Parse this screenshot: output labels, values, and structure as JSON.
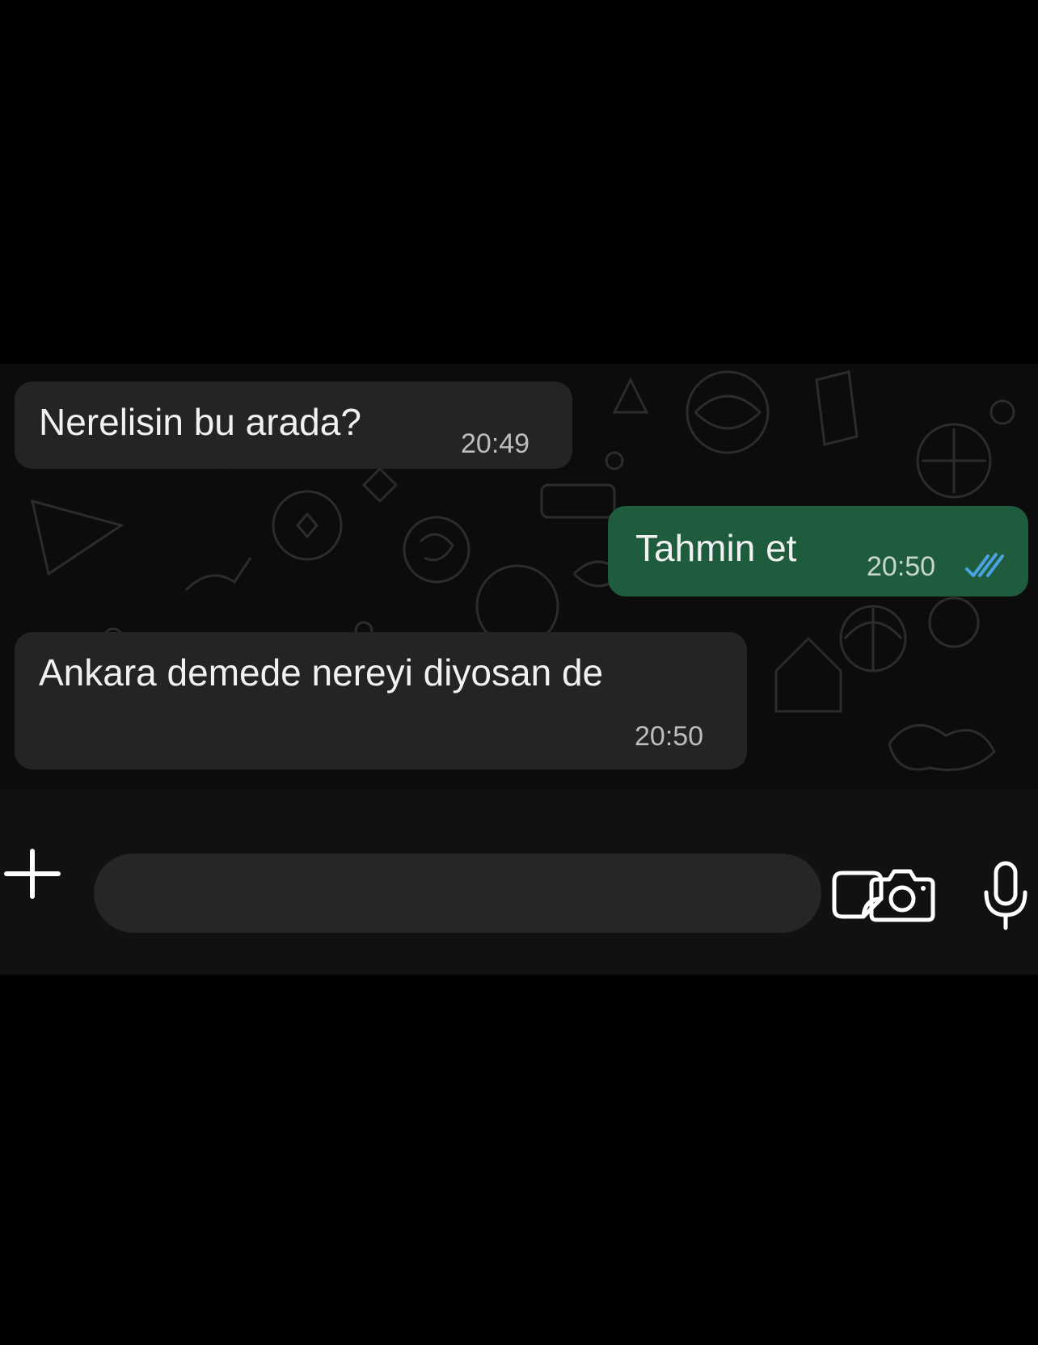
{
  "chat": {
    "messages": [
      {
        "direction": "incoming",
        "text": "Nerelisin bu arada?",
        "time": "20:49"
      },
      {
        "direction": "outgoing",
        "text": "Tahmin et",
        "time": "20:50",
        "status": "read"
      },
      {
        "direction": "incoming",
        "text": "Ankara demede nereyi diyosan de",
        "time": "20:50"
      }
    ]
  },
  "composer": {
    "plus_icon": "plus-icon",
    "sticker_icon": "sticker-icon",
    "camera_icon": "camera-icon",
    "mic_icon": "microphone-icon",
    "input_value": ""
  },
  "colors": {
    "incoming_bubble": "#242424",
    "outgoing_bubble": "#1e5c3d",
    "read_ticks": "#4aa3e0",
    "background": "#000000"
  }
}
